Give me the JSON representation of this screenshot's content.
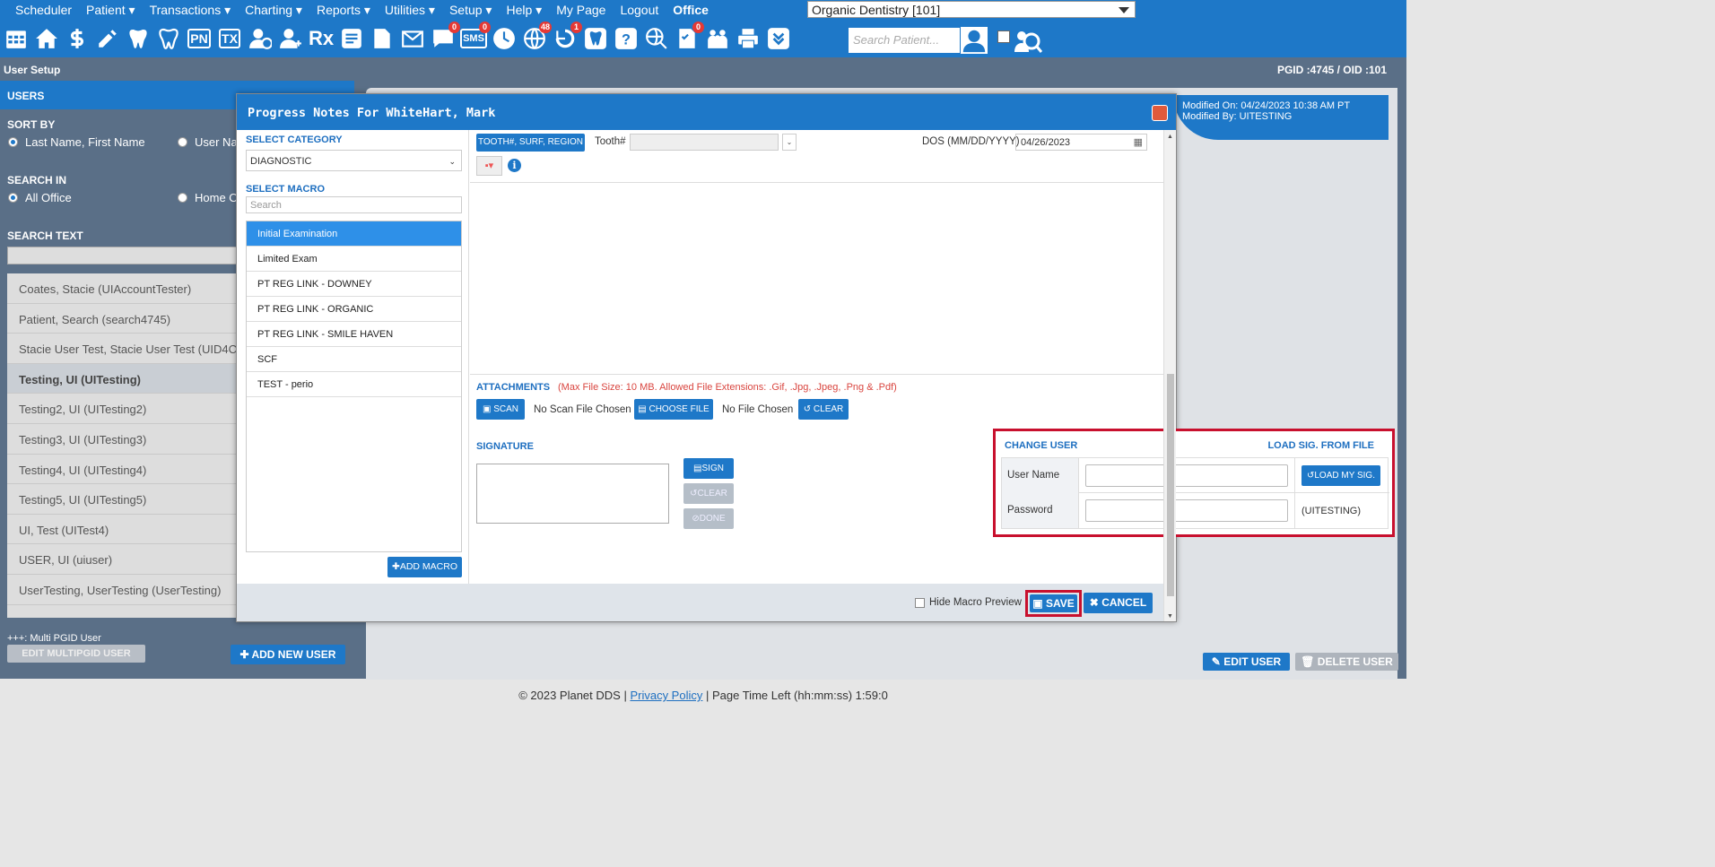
{
  "topmenu": {
    "items": [
      "Scheduler",
      "Patient",
      "Transactions",
      "Charting",
      "Reports",
      "Utilities",
      "Setup",
      "Help",
      "My Page",
      "Logout"
    ],
    "office_label": "Office",
    "office_value": "Organic Dentistry [101]"
  },
  "toolbar": {
    "icons": [
      "calendar-icon",
      "home-icon",
      "dollar-icon",
      "edit-icon",
      "tooth-icon",
      "tooth-outline-icon",
      "pn-icon",
      "tx-icon",
      "add-patient-icon",
      "add-user-icon",
      "rx-icon",
      "notes-icon",
      "document-icon",
      "email-icon",
      "chat-icon",
      "sms-icon",
      "clock-icon",
      "globe-icon",
      "recall-icon",
      "tooth-blue-icon",
      "tooth-question-icon",
      "web-search-icon",
      "checklist-icon",
      "family-icon",
      "print-icon",
      "download-icon"
    ],
    "pn": "PN",
    "tx": "TX",
    "rx": "Rx",
    "sms": "SMS",
    "badge_chat": "0",
    "badge_sms": "0",
    "badge_globe": "48",
    "badge_recall": "1",
    "badge_checklist": "0",
    "search_placeholder": "Search Patient..."
  },
  "subbar": {
    "title": "User Setup",
    "pgid": "PGID :4745 / OID :101"
  },
  "left": {
    "users_header": "USERS",
    "sort_by": "SORT BY",
    "sort_opt1": "Last Name, First Name",
    "sort_opt2": "User Na",
    "search_in": "SEARCH IN",
    "search_opt1": "All Office",
    "search_opt2": "Home O",
    "search_text": "SEARCH TEXT",
    "users": [
      "Coates, Stacie (UIAccountTester)",
      "Patient, Search (search4745)",
      "Stacie User Test, Stacie User Test (UID4C)",
      "Testing, UI (UITesting)",
      "Testing2, UI (UITesting2)",
      "Testing3, UI (UITesting3)",
      "Testing4, UI (UITesting4)",
      "Testing5, UI (UITesting5)",
      "UI, Test (UITest4)",
      "USER, UI (uiuser)",
      "UserTesting, UserTesting (UserTesting)"
    ],
    "multi_note": "+++: Multi PGID User",
    "edit_multi": "EDIT MULTIPGID USER",
    "add_user": "ADD NEW USER"
  },
  "content": {
    "modified_on": "Modified On: 04/24/2023 10:38 AM PT",
    "modified_by": "Modified By: UITESTING",
    "edit_user": "EDIT USER",
    "delete_user": "DELETE USER"
  },
  "footer": {
    "copyright": "© 2023 Planet DDS |",
    "privacy": "Privacy Policy",
    "time_left": "| Page Time Left (hh:mm:ss) 1:59:0"
  },
  "modal": {
    "title": "Progress Notes For WhiteHart, Mark",
    "select_category": "SELECT CATEGORY",
    "category_value": "DIAGNOSTIC",
    "select_macro": "SELECT MACRO",
    "macro_search_placeholder": "Search",
    "macros": [
      "Initial Examination",
      "Limited Exam",
      "PT REG LINK - DOWNEY",
      "PT REG LINK - ORGANIC",
      "PT REG LINK - SMILE HAVEN",
      "SCF",
      "TEST - perio"
    ],
    "add_macro": "ADD MACRO",
    "tooth_btn": "TOOTH#, SURF, REGION",
    "tooth_label": "Tooth#",
    "dos_label": "DOS (MM/DD/YYYY)",
    "dos_value": "04/26/2023",
    "attachments": "ATTACHMENTS",
    "attach_note": "(Max File Size: 10 MB. Allowed File Extensions: .Gif, .Jpg, .Jpeg, .Png & .Pdf)",
    "scan": "SCAN",
    "no_scan": "No Scan File Chosen",
    "choose_file": "CHOOSE FILE",
    "no_file": "No File Chosen",
    "clear": "CLEAR",
    "signature": "SIGNATURE",
    "sign": "SIGN",
    "sig_clear": "CLEAR",
    "sig_done": "DONE",
    "change_user": "CHANGE USER",
    "load_sig_file": "LOAD SIG. FROM FILE",
    "user_name": "User Name",
    "password": "Password",
    "load_my_sig": "LOAD MY SIG.",
    "current_user": "(UITESTING)",
    "hide_macro": "Hide Macro Preview",
    "save": "SAVE",
    "cancel": "CANCEL"
  }
}
